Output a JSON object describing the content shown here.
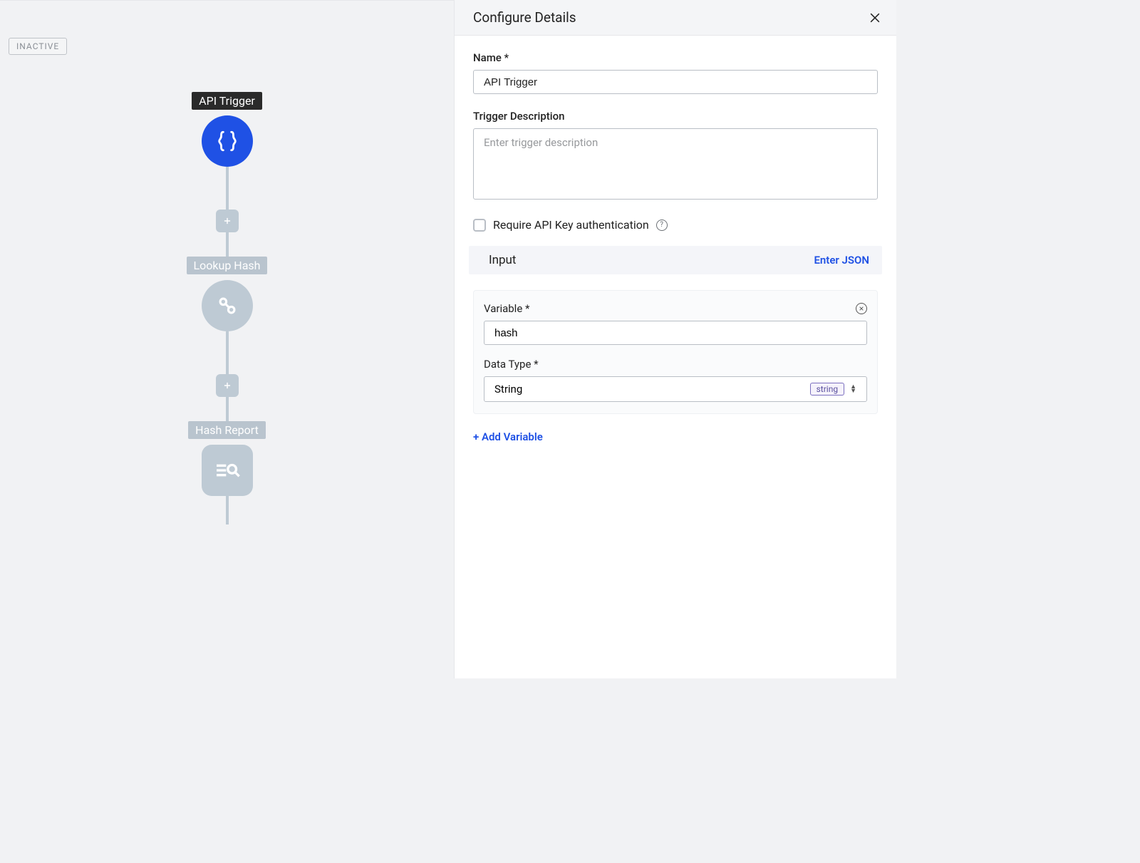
{
  "status_badge": "INACTIVE",
  "flow": {
    "node1_label": "API Trigger",
    "node2_label": "Lookup Hash",
    "node3_label": "Hash Report"
  },
  "panel": {
    "title": "Configure Details",
    "name_label": "Name *",
    "name_value": "API Trigger",
    "desc_label": "Trigger Description",
    "desc_placeholder": "Enter trigger description",
    "desc_value": "",
    "require_api_label": "Require API Key authentication",
    "input_section": "Input",
    "enter_json": "Enter JSON",
    "variable": {
      "var_label": "Variable *",
      "var_value": "hash",
      "type_label": "Data Type *",
      "type_value": "String",
      "type_tag": "string"
    },
    "add_variable": "+ Add Variable"
  }
}
